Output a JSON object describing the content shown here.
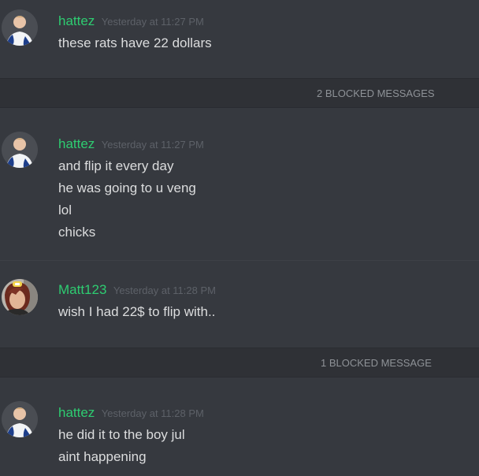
{
  "messages": [
    {
      "username": "hattez",
      "timestamp": "Yesterday at 11:27 PM",
      "lines": [
        "these rats have 22 dollars"
      ],
      "avatar_icon": "white-jersey-user-avatar"
    },
    {
      "username": "hattez",
      "timestamp": "Yesterday at 11:27 PM",
      "lines": [
        "and flip it every day",
        "he was going to u veng",
        "lol",
        "chicks"
      ],
      "avatar_icon": "white-jersey-user-avatar"
    },
    {
      "username": "Matt123",
      "timestamp": "Yesterday at 11:28 PM",
      "lines": [
        "wish I had 22$ to flip with.."
      ],
      "avatar_icon": "red-haired-user-avatar"
    },
    {
      "username": "hattez",
      "timestamp": "Yesterday at 11:28 PM",
      "lines": [
        "he did it to the boy jul",
        "aint happening"
      ],
      "avatar_icon": "white-jersey-user-avatar"
    }
  ],
  "blocked": [
    {
      "label": "2 BLOCKED MESSAGES"
    },
    {
      "label": "1 BLOCKED MESSAGE"
    }
  ],
  "colors": {
    "background": "#36393f",
    "username": "#2ecc71",
    "message_text": "#dcddde",
    "timestamp": "#5d6168",
    "blocked_bar": "#2f3136",
    "blocked_text": "#8e9297"
  }
}
